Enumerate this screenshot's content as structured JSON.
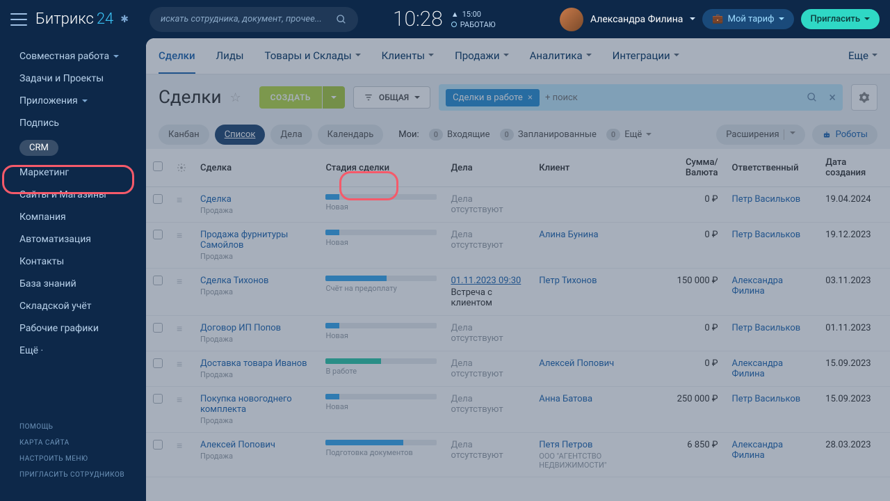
{
  "brand": {
    "name": "Битрикс",
    "suffix": "24"
  },
  "search": {
    "placeholder": "искать сотрудника, документ, прочее..."
  },
  "clock": {
    "time": "10:28",
    "scheduled": "15:00",
    "status": "РАБОТАЮ"
  },
  "user": {
    "name": "Александра Филина"
  },
  "header_buttons": {
    "tariff": "Мой тариф",
    "invite": "Пригласить"
  },
  "sidebar": {
    "items": [
      {
        "label": "Совместная работа",
        "has_chev": true
      },
      {
        "label": "Задачи и Проекты"
      },
      {
        "label": "Приложения",
        "has_chev": true
      },
      {
        "label": "Подпись"
      },
      {
        "label": "CRM",
        "active": true
      },
      {
        "label": "Маркетинг"
      },
      {
        "label": "Сайты и Магазины"
      },
      {
        "label": "Компания"
      },
      {
        "label": "Автоматизация"
      },
      {
        "label": "Контакты"
      },
      {
        "label": "База знаний"
      },
      {
        "label": "Складской учёт"
      },
      {
        "label": "Рабочие графики"
      },
      {
        "label": "Ещё ·"
      }
    ],
    "helpers": [
      "ПОМОЩЬ",
      "КАРТА САЙТА",
      "НАСТРОИТЬ МЕНЮ",
      "ПРИГЛАСИТЬ СОТРУДНИКОВ"
    ]
  },
  "tabs": [
    {
      "label": "Сделки",
      "active": true
    },
    {
      "label": "Лиды"
    },
    {
      "label": "Товары и Склады",
      "chev": true
    },
    {
      "label": "Клиенты",
      "chev": true
    },
    {
      "label": "Продажи",
      "chev": true
    },
    {
      "label": "Аналитика",
      "chev": true
    },
    {
      "label": "Интеграции",
      "chev": true
    },
    {
      "label": "Еще",
      "chev": true,
      "right": true
    }
  ],
  "page": {
    "title": "Сделки",
    "create": "СОЗДАТЬ",
    "filter_label": "ОБЩАЯ",
    "filter_tag": "Сделки в работе",
    "filter_placeholder": "+ поиск"
  },
  "views": {
    "items": [
      "Канбан",
      "Список",
      "Дела",
      "Календарь"
    ],
    "active": 1,
    "my_label": "Мои:",
    "incoming": "Входящие",
    "incoming_count": "0",
    "planned": "Запланированные",
    "planned_count": "0",
    "more": "Ещё",
    "more_count": "0",
    "extensions": "Расширения",
    "robots": "Роботы"
  },
  "columns": [
    "Сделка",
    "Стадия сделки",
    "Дела",
    "Клиент",
    "Сумма/Валюта",
    "Ответственный",
    "Дата создания"
  ],
  "rows": [
    {
      "title": "Сделка",
      "sub": "Продажа",
      "stage": {
        "label": "Новая",
        "pct": 12,
        "color": "#39a8ef"
      },
      "deals": "Дела отсутствуют",
      "client": "",
      "amount": "0 ₽",
      "resp": "Петр Васильков",
      "date": "19.04.2024"
    },
    {
      "title": "Продажа фурнитуры Самойлов",
      "sub": "Продажа",
      "stage": {
        "label": "Новая",
        "pct": 12,
        "color": "#39a8ef"
      },
      "deals": "Дела отсутствуют",
      "client": "Алина Бунина",
      "amount": "0 ₽",
      "resp": "Петр Васильков",
      "date": "19.12.2023"
    },
    {
      "title": "Сделка Тихонов",
      "sub": "Продажа",
      "stage": {
        "label": "Счёт на предоплату",
        "pct": 55,
        "color": "#39a8ef"
      },
      "deal_link": "01.11.2023 09:30",
      "deal_text": "Встреча с клиентом",
      "client": "Петр Тихонов",
      "amount": "150 000 ₽",
      "resp": "Александра Филина",
      "date": "03.11.2023"
    },
    {
      "title": "Договор ИП Попов",
      "sub": "Продажа",
      "stage": {
        "label": "Новая",
        "pct": 12,
        "color": "#39a8ef"
      },
      "deals": "Дела отсутствуют",
      "client": "",
      "amount": "0 ₽",
      "resp": "Петр Васильков",
      "date": "01.11.2023"
    },
    {
      "title": "Доставка товара Иванов",
      "sub": "Продажа",
      "stage": {
        "label": "В работе",
        "pct": 50,
        "color": "#2fc9a9"
      },
      "deals": "Дела отсутствуют",
      "client": "Алексей Попович",
      "amount": "0 ₽",
      "resp": "Александра Филина",
      "date": "15.09.2023"
    },
    {
      "title": "Покупка новогоднего комплекта",
      "sub": "Продажа",
      "stage": {
        "label": "Новая",
        "pct": 12,
        "color": "#39a8ef"
      },
      "deals": "Дела отсутствуют",
      "client": "Анна Батова",
      "amount": "250 000 ₽",
      "resp": "Петр Васильков",
      "date": "15.09.2023"
    },
    {
      "title": "Алексей Попович",
      "sub": "Продажа",
      "stage": {
        "label": "Подготовка документов",
        "pct": 70,
        "color": "#39a8ef"
      },
      "deals": "Дела отсутствуют",
      "client": "Петя Петров",
      "client_sub": "ООО \"АГЕНТСТВО НЕДВИЖИМОСТИ\"",
      "amount": "6 850 ₽",
      "resp": "Александра Филина",
      "date": "28.03.2023"
    }
  ]
}
